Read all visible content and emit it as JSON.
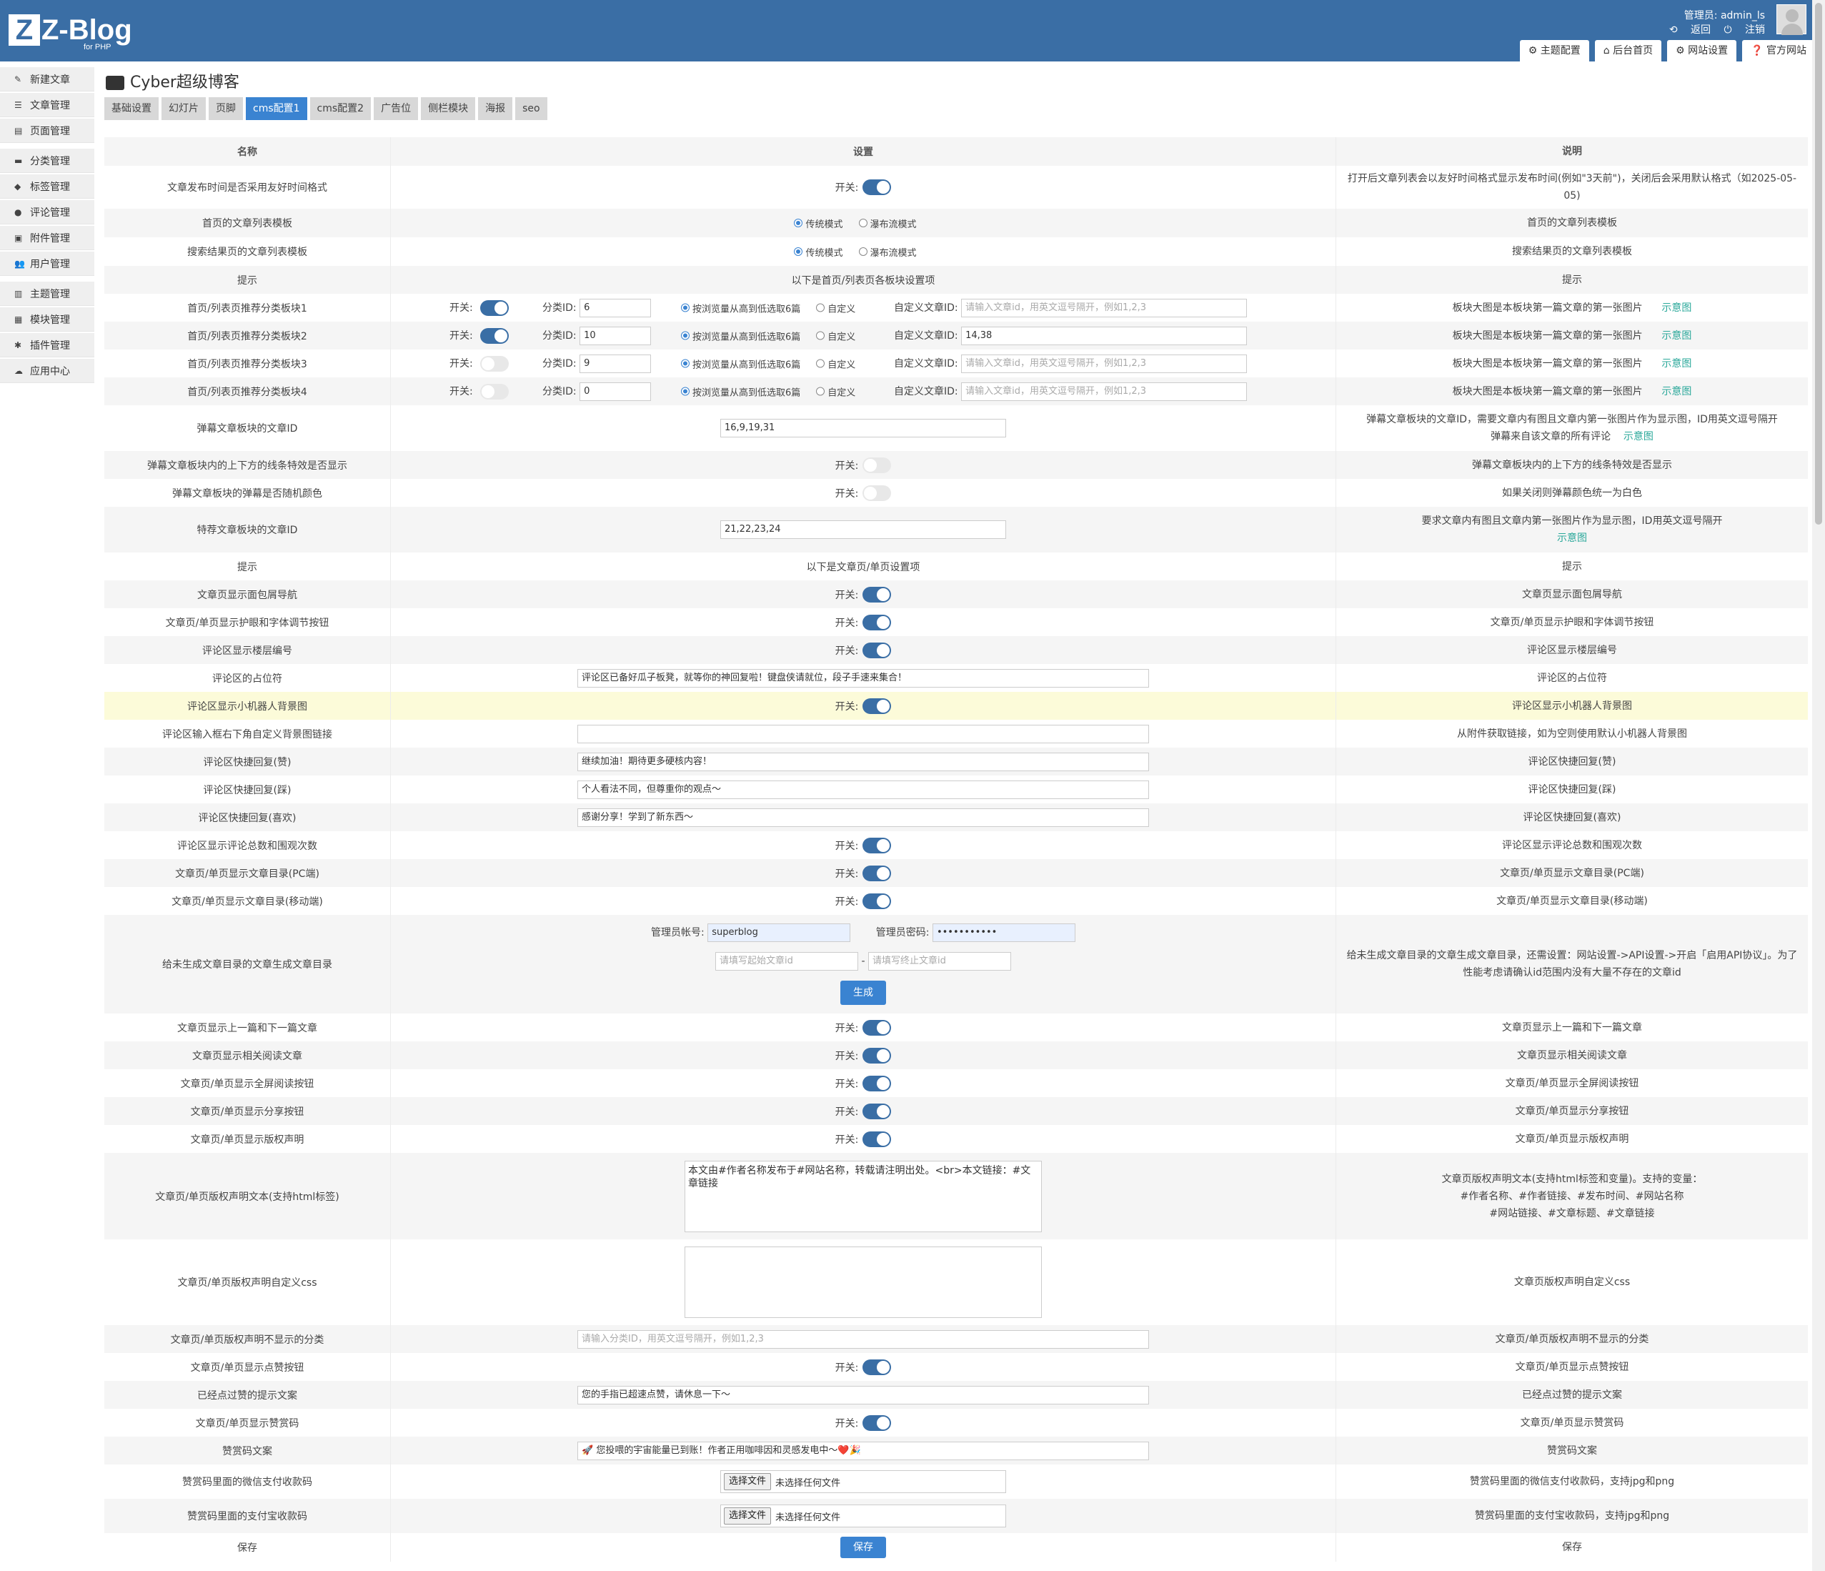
{
  "logo": {
    "mark": "Z",
    "text": "Z-Blog",
    "sub": "for PHP"
  },
  "header": {
    "user_label": "管理员: admin_ls",
    "return_label": "返回",
    "logout_label": "注销",
    "top_tabs": [
      "主题配置",
      "后台首页",
      "网站设置",
      "官方网站"
    ]
  },
  "sidebar": {
    "items": [
      "新建文章",
      "文章管理",
      "页面管理",
      "分类管理",
      "标签管理",
      "评论管理",
      "附件管理",
      "用户管理",
      "主题管理",
      "模块管理",
      "插件管理",
      "应用中心"
    ]
  },
  "page": {
    "title": "Cyber超级博客",
    "tabs": [
      "基础设置",
      "幻灯片",
      "页脚",
      "cms配置1",
      "cms配置2",
      "广告位",
      "侧栏模块",
      "海报",
      "seo"
    ],
    "active_tab": "cms配置1"
  },
  "table_header": {
    "name": "名称",
    "setting": "设置",
    "desc": "说明"
  },
  "common": {
    "switch_label": "开关:",
    "cat_id_label": "分类ID:",
    "radio_auto": "按浏览量从高到低选取6篇",
    "radio_custom": "自定义",
    "custom_ids_label": "自定义文章ID:",
    "custom_ids_placeholder": "请输入文章id，用英文逗号隔开，例如1,2,3",
    "diagram_link": "示意图",
    "block_desc": "板块大图是本板块第一篇文章的第一张图片",
    "list_mode_trad": "传统模式",
    "list_mode_flow": "瀑布流模式"
  },
  "rows": {
    "r1": {
      "name": "文章发布时间是否采用友好时间格式",
      "desc": "打开后文章列表会以友好时间格式显示发布时间(例如\"3天前\")，关闭后会采用默认格式（如2025-05-05)"
    },
    "r2": {
      "name": "首页的文章列表模板",
      "desc": "首页的文章列表模板"
    },
    "r3": {
      "name": "搜索结果页的文章列表模板",
      "desc": "搜索结果页的文章列表模板"
    },
    "r4": {
      "name": "提示",
      "setting": "以下是首页/列表页各板块设置项",
      "desc": "提示"
    },
    "blocks": [
      {
        "name": "首页/列表页推荐分类板块1",
        "cat_id": "6",
        "custom_ids": ""
      },
      {
        "name": "首页/列表页推荐分类板块2",
        "cat_id": "10",
        "custom_ids": "14,38"
      },
      {
        "name": "首页/列表页推荐分类板块3",
        "cat_id": "9",
        "custom_ids": ""
      },
      {
        "name": "首页/列表页推荐分类板块4",
        "cat_id": "0",
        "custom_ids": ""
      }
    ],
    "r9": {
      "name": "弹幕文章板块的文章ID",
      "value": "16,9,19,31",
      "desc1": "弹幕文章板块的文章ID，需要文章内有图且文章内第一张图片作为显示图，ID用英文逗号隔开",
      "desc2": "弹幕来自该文章的所有评论"
    },
    "r10": {
      "name": "弹幕文章板块内的上下方的线条特效是否显示",
      "desc": "弹幕文章板块内的上下方的线条特效是否显示"
    },
    "r11": {
      "name": "弹幕文章板块的弹幕是否随机颜色",
      "desc": "如果关闭则弹幕颜色统一为白色"
    },
    "r12": {
      "name": "特荐文章板块的文章ID",
      "value": "21,22,23,24",
      "desc1": "要求文章内有图且文章内第一张图片作为显示图，ID用英文逗号隔开"
    },
    "r13": {
      "name": "提示",
      "setting": "以下是文章页/单页设置项",
      "desc": "提示"
    },
    "r14": {
      "name": "文章页显示面包屑导航",
      "desc": "文章页显示面包屑导航"
    },
    "r15": {
      "name": "文章页/单页显示护眼和字体调节按钮",
      "desc": "文章页/单页显示护眼和字体调节按钮"
    },
    "r16": {
      "name": "评论区显示楼层编号",
      "desc": "评论区显示楼层编号"
    },
    "r17": {
      "name": "评论区的占位符",
      "value": "评论区已备好瓜子板凳，就等你的神回复啦！键盘侠请就位，段子手速来集合！",
      "desc": "评论区的占位符"
    },
    "r18": {
      "name": "评论区显示小机器人背景图",
      "desc": "评论区显示小机器人背景图"
    },
    "r19": {
      "name": "评论区输入框右下角自定义背景图链接",
      "value": "",
      "desc": "从附件获取链接，如为空则使用默认小机器人背景图"
    },
    "r20": {
      "name": "评论区快捷回复(赞)",
      "value": "继续加油！期待更多硬核内容！",
      "desc": "评论区快捷回复(赞)"
    },
    "r21": {
      "name": "评论区快捷回复(踩)",
      "value": "个人看法不同，但尊重你的观点～",
      "desc": "评论区快捷回复(踩)"
    },
    "r22": {
      "name": "评论区快捷回复(喜欢)",
      "value": "感谢分享！学到了新东西～",
      "desc": "评论区快捷回复(喜欢)"
    },
    "r23": {
      "name": "评论区显示评论总数和围观次数",
      "desc": "评论区显示评论总数和围观次数"
    },
    "r24": {
      "name": "文章页/单页显示文章目录(PC端)",
      "desc": "文章页/单页显示文章目录(PC端)"
    },
    "r25": {
      "name": "文章页/单页显示文章目录(移动端)",
      "desc": "文章页/单页显示文章目录(移动端)"
    },
    "r26": {
      "name": "给未生成文章目录的文章生成文章目录",
      "admin_label": "管理员帐号:",
      "admin_value": "superblog",
      "pwd_label": "管理员密码:",
      "pwd_value": "•••••••••••",
      "start_ph": "请填写起始文章id",
      "end_ph": "请填写终止文章id",
      "dash": "-",
      "btn": "生成",
      "desc": "给未生成文章目录的文章生成文章目录，还需设置：网站设置->API设置->开启「启用API协议」。为了性能考虑请确认id范围内没有大量不存在的文章id"
    },
    "r27": {
      "name": "文章页显示上一篇和下一篇文章",
      "desc": "文章页显示上一篇和下一篇文章"
    },
    "r28": {
      "name": "文章页显示相关阅读文章",
      "desc": "文章页显示相关阅读文章"
    },
    "r29": {
      "name": "文章页/单页显示全屏阅读按钮",
      "desc": "文章页/单页显示全屏阅读按钮"
    },
    "r30": {
      "name": "文章页/单页显示分享按钮",
      "desc": "文章页/单页显示分享按钮"
    },
    "r31": {
      "name": "文章页/单页显示版权声明",
      "desc": "文章页/单页显示版权声明"
    },
    "r32": {
      "name": "文章页/单页版权声明文本(支持html标签)",
      "value": "本文由#作者名称发布于#网站名称，转载请注明出处。<br>本文链接：#文章链接",
      "desc1": "文章页版权声明文本(支持html标签和变量)。支持的变量：",
      "desc2": "#作者名称、#作者链接、#发布时间、#网站名称",
      "desc3": "#网站链接、#文章标题、#文章链接"
    },
    "r33": {
      "name": "文章页/单页版权声明自定义css",
      "value": "",
      "desc": "文章页版权声明自定义css"
    },
    "r34": {
      "name": "文章页/单页版权声明不显示的分类",
      "placeholder": "请输入分类ID，用英文逗号隔开，例如1,2,3",
      "desc": "文章页/单页版权声明不显示的分类"
    },
    "r35": {
      "name": "文章页/单页显示点赞按钮",
      "desc": "文章页/单页显示点赞按钮"
    },
    "r36": {
      "name": "已经点过赞的提示文案",
      "value": "您的手指已超速点赞，请休息一下～",
      "desc": "已经点过赞的提示文案"
    },
    "r37": {
      "name": "文章页/单页显示赞赏码",
      "desc": "文章页/单页显示赞赏码"
    },
    "r38": {
      "name": "赞赏码文案",
      "value": "🚀 您投喂的宇宙能量已到账！作者正用咖啡因和灵感发电中～❤️🎉",
      "desc": "赞赏码文案"
    },
    "r39": {
      "name": "赞赏码里面的微信支付收款码",
      "desc": "赞赏码里面的微信支付收款码，支持jpg和png"
    },
    "r40": {
      "name": "赞赏码里面的支付宝收款码",
      "desc": "赞赏码里面的支付宝收款码，支持jpg和png"
    },
    "r41": {
      "name": "保存",
      "btn": "保存",
      "desc": "保存"
    }
  },
  "file": {
    "choose": "选择文件",
    "none": "未选择任何文件"
  },
  "colors": {
    "header": "#3a6ea5",
    "accent": "#3a83d1",
    "link": "#2aa89a"
  }
}
